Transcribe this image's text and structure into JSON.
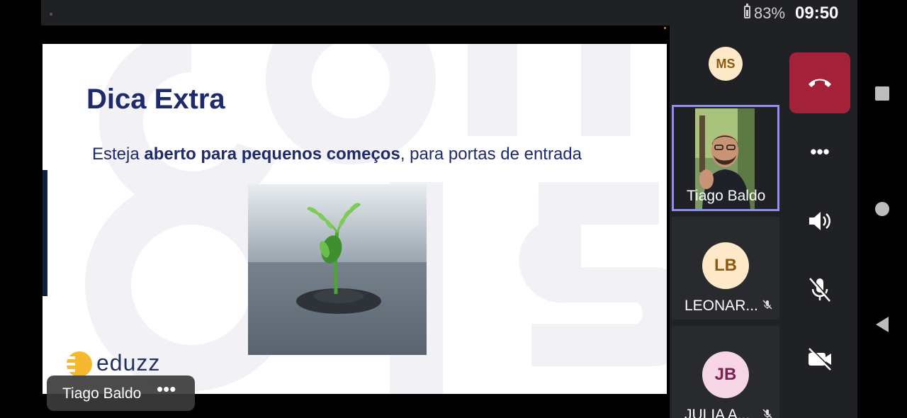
{
  "status_bar": {
    "battery": "83%",
    "time": "09:50"
  },
  "slide": {
    "title": "Dica Extra",
    "subtitle_pre": "Esteja ",
    "subtitle_bold": "aberto para pequenos começos",
    "subtitle_post": ", para portas de entrada",
    "logo_text": "eduzz"
  },
  "presenter_label": {
    "name": "Tiago Baldo",
    "more": "•••"
  },
  "participants": [
    {
      "initials": "MS",
      "name": ""
    },
    {
      "initials": "",
      "name": "Tiago Baldo"
    },
    {
      "initials": "LB",
      "name": "LEONAR..."
    },
    {
      "initials": "JB",
      "name": "JULIA A..."
    }
  ],
  "controls": {
    "more": "•••"
  },
  "colors": {
    "hangup": "#a3223a",
    "active_border": "#8d90ef",
    "slide_title": "#1f2a6b"
  }
}
